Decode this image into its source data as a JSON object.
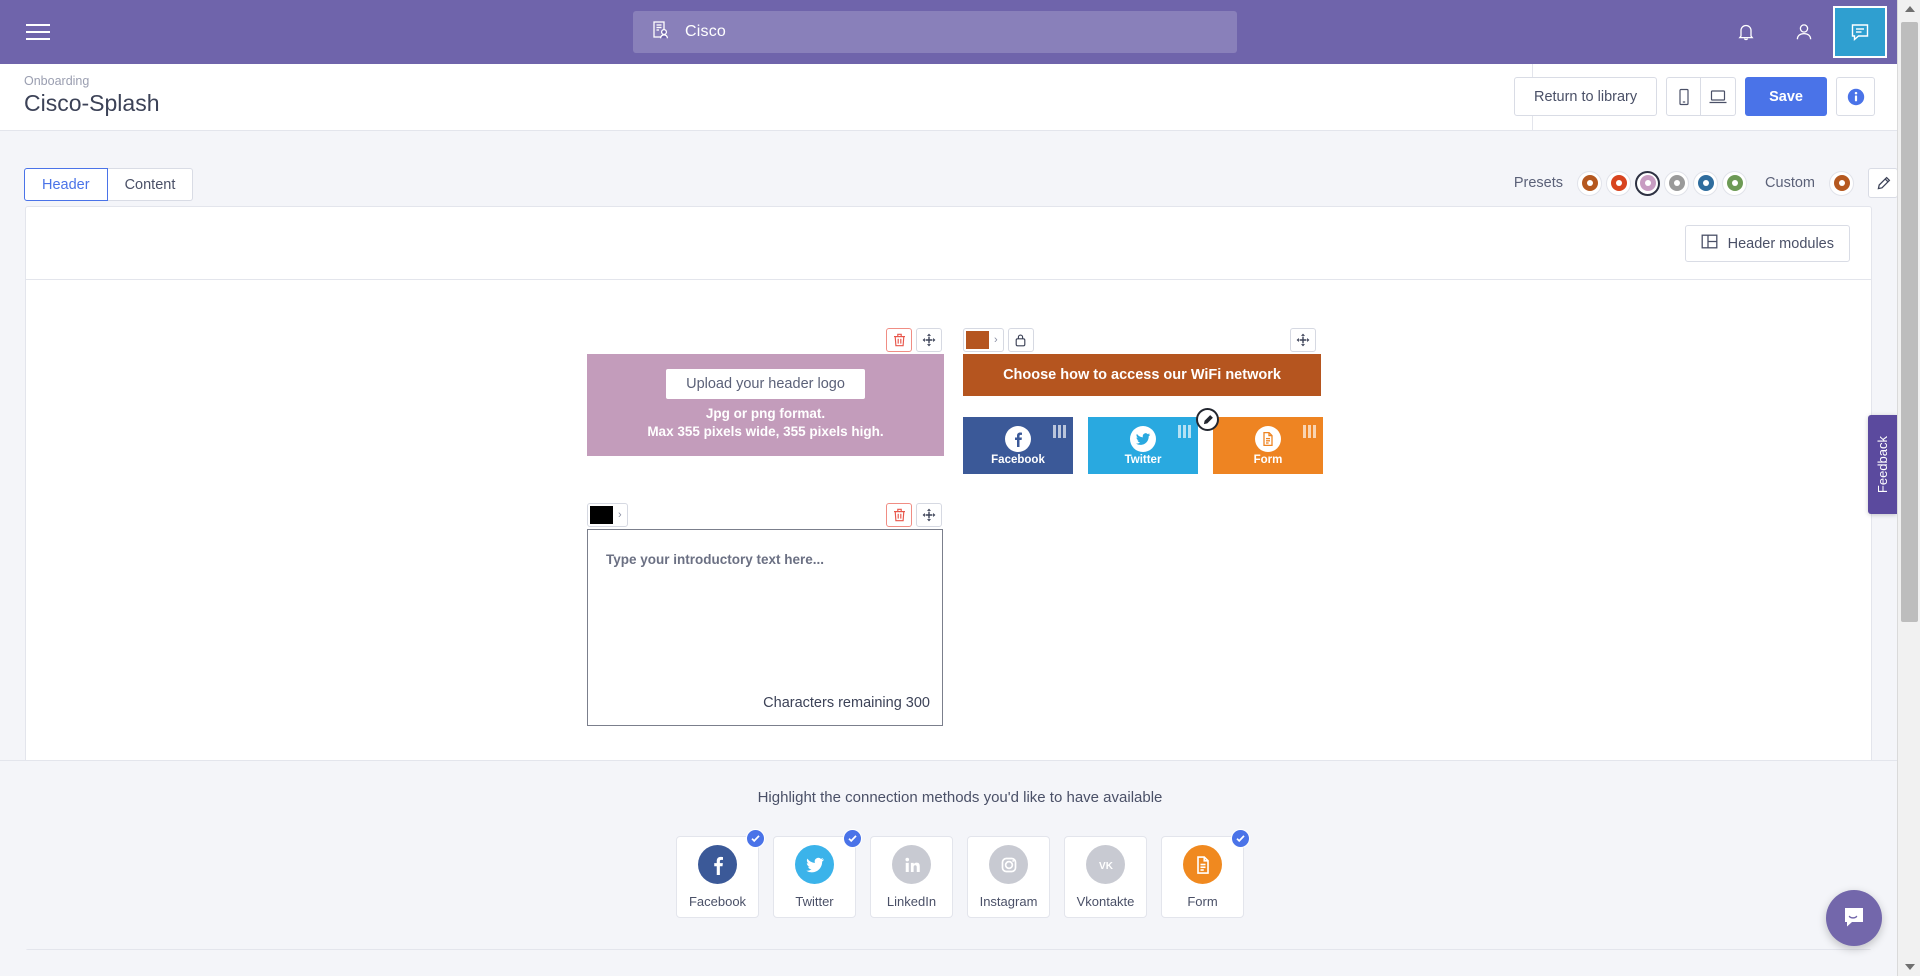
{
  "topbar": {
    "menu_icon": "hamburger-icon",
    "search": {
      "value": "Cisco",
      "icon": "organization-person-icon"
    },
    "icons": [
      {
        "name": "notifications-bell-icon"
      },
      {
        "name": "user-account-icon"
      },
      {
        "name": "messages-chat-icon",
        "active": true
      }
    ]
  },
  "subheader": {
    "breadcrumb": "Onboarding",
    "title": "Cisco-Splash",
    "return_label": "Return to library",
    "device_mobile_icon": "mobile-preview-icon",
    "device_desktop_icon": "desktop-preview-icon",
    "save_label": "Save",
    "info_label": "i"
  },
  "toolbar": {
    "tabs": [
      {
        "label": "Header",
        "active": true
      },
      {
        "label": "Content",
        "active": false
      }
    ],
    "presets_label": "Presets",
    "custom_label": "Custom",
    "presets": [
      {
        "color": "#b5581f",
        "selected": false
      },
      {
        "color": "#d8441f",
        "selected": false
      },
      {
        "color": "#c89cc2",
        "selected": true
      },
      {
        "color": "#9a9a9a",
        "selected": false
      },
      {
        "color": "#2f6d9e",
        "selected": false
      },
      {
        "color": "#6d9a55",
        "selected": false
      }
    ],
    "custom_color": "#b5581f",
    "eyedropper_icon": "color-picker-pencil-icon"
  },
  "canvas": {
    "header_modules_label": "Header modules",
    "logo_module": {
      "upload_label": "Upload your header logo",
      "note_line1": "Jpg or png format.",
      "note_line2": "Max 355 pixels wide, 355 pixels high.",
      "background": "#c39cbb",
      "delete_icon": "trash-icon",
      "move_icon": "move-handle-icon"
    },
    "wifi_module": {
      "banner_text": "Choose how to access our WiFi network",
      "banner_color": "#b5551f",
      "swatch_chevron": "›",
      "lock_icon": "lock-icon",
      "move_icon": "move-handle-icon",
      "tiles": [
        {
          "label": "Facebook",
          "color": "#3b5998",
          "icon": "facebook-icon",
          "editable": false
        },
        {
          "label": "Twitter",
          "color": "#29a9e0",
          "icon": "twitter-icon",
          "editable": false
        },
        {
          "label": "Form",
          "color": "#ee8422",
          "icon": "form-document-icon",
          "editable": true
        }
      ]
    },
    "intro_module": {
      "swatch_color": "#000000",
      "swatch_chevron": "›",
      "placeholder": "Type your introductory text here...",
      "counter": "Characters remaining 300",
      "delete_icon": "trash-icon",
      "move_icon": "move-handle-icon"
    }
  },
  "connections": {
    "title": "Highlight the connection methods you'd like to have available",
    "items": [
      {
        "label": "Facebook",
        "icon": "facebook-icon",
        "color": "#3b5998",
        "enabled": true
      },
      {
        "label": "Twitter",
        "icon": "twitter-icon",
        "color": "#3bb3ea",
        "enabled": true
      },
      {
        "label": "LinkedIn",
        "icon": "linkedin-icon",
        "color": "#c8cad2",
        "enabled": false
      },
      {
        "label": "Instagram",
        "icon": "instagram-icon",
        "color": "#c8cad2",
        "enabled": false
      },
      {
        "label": "Vkontakte",
        "icon": "vkontakte-icon",
        "color": "#c8cad2",
        "enabled": false
      },
      {
        "label": "Form",
        "icon": "form-document-icon",
        "color": "#f0891f",
        "enabled": true
      }
    ],
    "check_glyph": "✔"
  },
  "widgets": {
    "feedback_label": "Feedback",
    "chat_icon": "intercom-chat-icon"
  }
}
